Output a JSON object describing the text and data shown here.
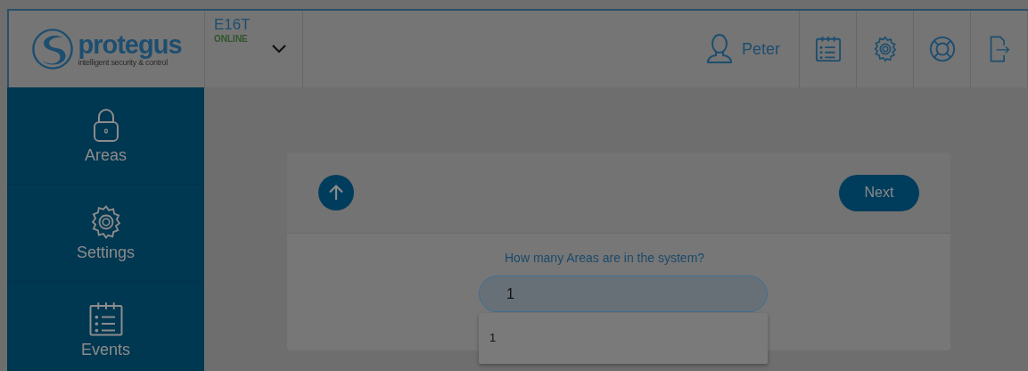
{
  "header": {
    "logo": {
      "name": "protegus",
      "tagline": "intelligent security & control"
    },
    "device": {
      "name": "E16T",
      "status": "ONLINE"
    },
    "user": {
      "name": "Peter"
    },
    "tools": [
      {
        "kind": "events"
      },
      {
        "kind": "settings"
      },
      {
        "kind": "help"
      },
      {
        "kind": "logout"
      }
    ]
  },
  "sidebar": {
    "items": [
      {
        "label": "Areas",
        "kind": "areas"
      },
      {
        "label": "Settings",
        "kind": "settings"
      },
      {
        "label": "Events",
        "kind": "events"
      }
    ]
  },
  "wizard": {
    "next": "Next",
    "question": "How many Areas are in the system?",
    "value": "1",
    "suggestions": [
      "1"
    ]
  }
}
